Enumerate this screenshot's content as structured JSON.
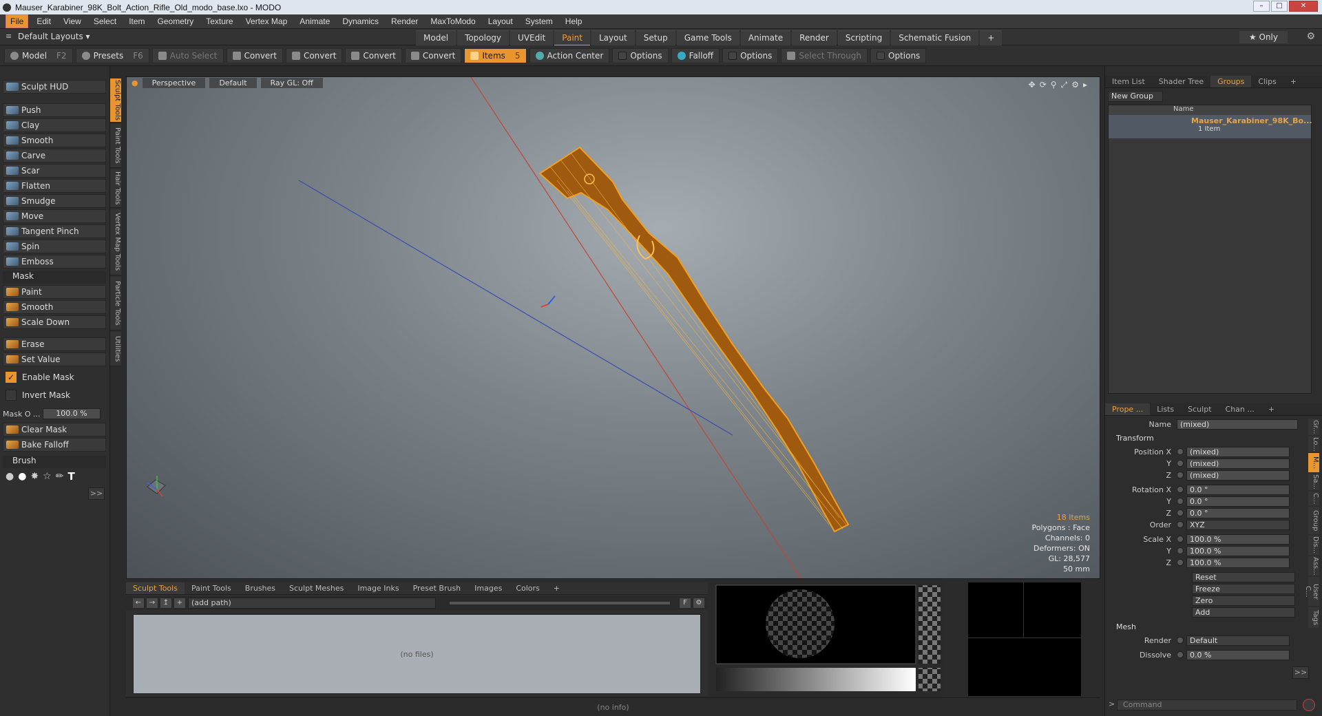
{
  "window": {
    "title": "Mauser_Karabiner_98K_Bolt_Action_Rifle_Old_modo_base.lxo - MODO"
  },
  "menu": [
    "File",
    "Edit",
    "View",
    "Select",
    "Item",
    "Geometry",
    "Texture",
    "Vertex Map",
    "Animate",
    "Dynamics",
    "Render",
    "MaxToModo",
    "Layout",
    "System",
    "Help"
  ],
  "layout": {
    "label": "Default Layouts ▾",
    "tabs": [
      "Model",
      "Topology",
      "UVEdit",
      "Paint",
      "Layout",
      "Setup",
      "Game Tools",
      "Animate",
      "Render",
      "Scripting",
      "Schematic Fusion"
    ],
    "active_tab": "Paint",
    "only": "★ Only"
  },
  "toolbar": {
    "model": "Model",
    "model_key": "F2",
    "presets": "Presets",
    "presets_key": "F6",
    "auto_select": "Auto Select",
    "convert1": "Convert",
    "convert2": "Convert",
    "convert3": "Convert",
    "convert4": "Convert",
    "items": "Items",
    "action_center": "Action Center",
    "options1": "Options",
    "falloff": "Falloff",
    "options2": "Options",
    "select_through": "Select Through",
    "options3": "Options"
  },
  "left": {
    "hud": "Sculpt HUD",
    "tools": [
      "Push",
      "Clay",
      "Smooth",
      "Carve",
      "Scar",
      "Flatten",
      "Smudge",
      "Move",
      "Tangent Pinch",
      "Spin",
      "Emboss"
    ],
    "mask_section": "Mask",
    "mask_tools": [
      "Paint",
      "Smooth",
      "Scale Down"
    ],
    "erase": "Erase",
    "set_value": "Set Value",
    "enable_mask": "Enable Mask",
    "invert_mask": "Invert Mask",
    "mask_opacity_label": "Mask O ...",
    "mask_opacity_value": "100.0 %",
    "clear_mask": "Clear Mask",
    "bake_falloff": "Bake Falloff",
    "brush_section": "Brush",
    "more": ">>"
  },
  "sidetabs": [
    "Sculpt Tools",
    "Paint Tools",
    "Hair Tools",
    "Vertex Map Tools",
    "Particle Tools",
    "Utilities"
  ],
  "viewport": {
    "view": "Perspective",
    "shading": "Default",
    "raygl": "Ray GL: Off",
    "info": {
      "items": "18 Items",
      "polygons": "Polygons : Face",
      "channels": "Channels: 0",
      "deformers": "Deformers: ON",
      "gl": "GL: 28,577",
      "scale": "50 mm"
    }
  },
  "bottom": {
    "tabs": [
      "Sculpt Tools",
      "Paint Tools",
      "Brushes",
      "Sculpt Meshes",
      "Image Inks",
      "Preset Brush",
      "Images",
      "Colors"
    ],
    "path": "(add path)",
    "nofiles": "(no files)",
    "status": "(no info)",
    "f_label": "F"
  },
  "right": {
    "tabs": [
      "Item List",
      "Shader Tree",
      "Groups",
      "Clips"
    ],
    "active_tab": "Groups",
    "new_group": "New Group",
    "col_name": "Name",
    "group_name": "Mauser_Karabiner_98K_Bo...",
    "group_sub": "1 Item",
    "prop_tabs": [
      "Prope ...",
      "Lists",
      "Sculpt",
      "Chan ..."
    ],
    "name_label": "Name",
    "name_value": "(mixed)",
    "transform": "Transform",
    "pos_x_label": "Position X",
    "pos_x": "(mixed)",
    "pos_y": "(mixed)",
    "pos_z": "(mixed)",
    "rot_x_label": "Rotation X",
    "rot_x": "0.0 °",
    "rot_y": "0.0 °",
    "rot_z": "0.0 °",
    "order_label": "Order",
    "order": "XYZ",
    "scale_x_label": "Scale X",
    "scale_x": "100.0 %",
    "scale_y": "100.0 %",
    "scale_z": "100.0 %",
    "y": "Y",
    "z": "Z",
    "reset": "Reset",
    "freeze": "Freeze",
    "zero": "Zero",
    "add": "Add",
    "mesh": "Mesh",
    "render_label": "Render",
    "render": "Default",
    "dissolve_label": "Dissolve",
    "dissolve": "0.0 %",
    "more": ">>",
    "command": "Command",
    "vtabs": [
      "Gr...",
      "Lo...",
      "M...",
      "Sa...",
      "C...",
      "Group",
      "Dis...",
      "Ass...",
      "User C...",
      "Tags"
    ]
  },
  "colors": {
    "accent": "#e8962d",
    "rifle": "#f0a020"
  }
}
